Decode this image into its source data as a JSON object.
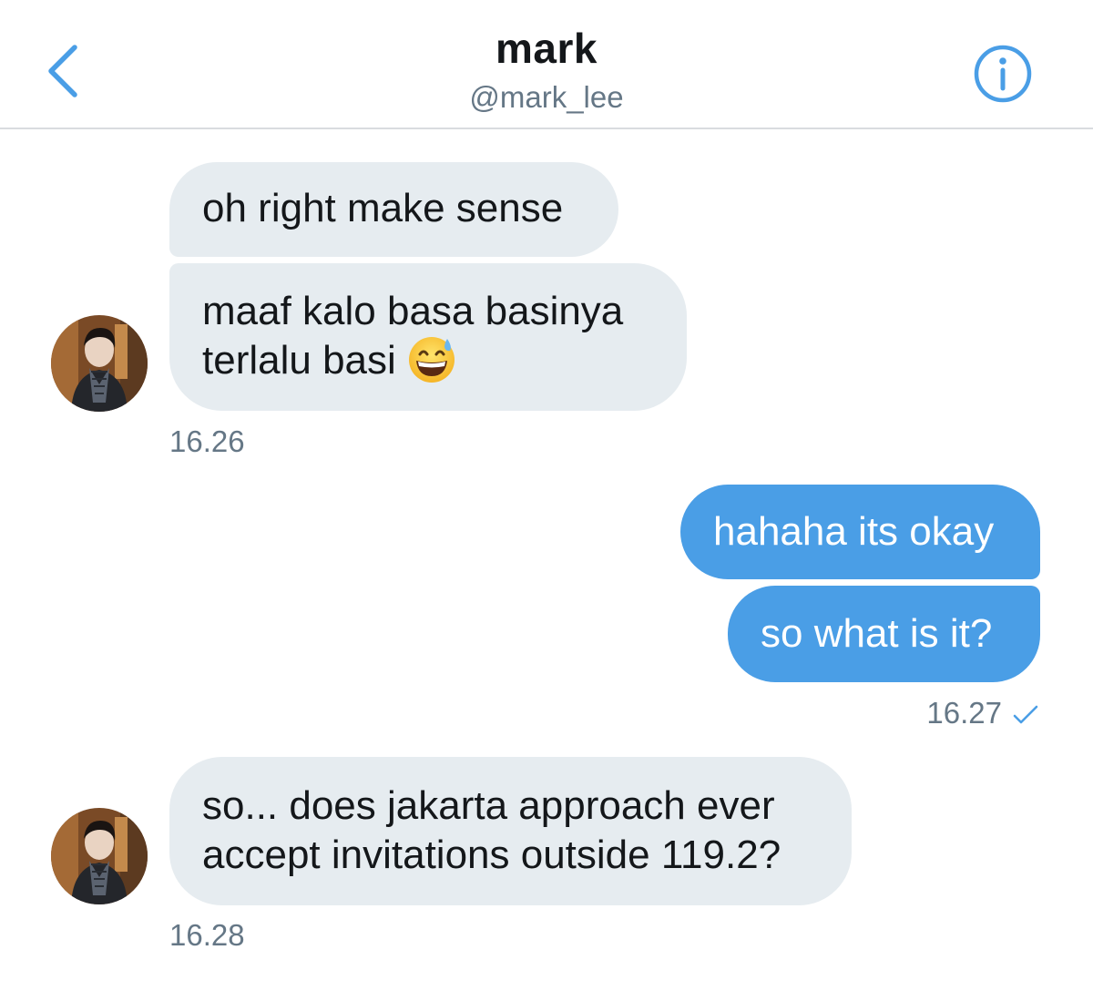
{
  "header": {
    "name": "mark",
    "handle": "@mark_lee"
  },
  "colors": {
    "accent": "#4a9ee6",
    "received_bubble": "#e6ecf0",
    "muted_text": "#657786"
  },
  "icons": {
    "back": "chevron-left-icon",
    "info": "info-circle-icon",
    "emoji": "grinning-sweat-emoji-icon",
    "read": "checkmark-icon"
  },
  "messages": [
    {
      "from": "them",
      "text": "oh right make sense"
    },
    {
      "from": "them",
      "lines": [
        "maaf kalo basa basinya",
        "terlalu basi"
      ]
    },
    {
      "from": "me",
      "text": "hahaha its okay"
    },
    {
      "from": "me",
      "text": "so what is it?"
    },
    {
      "from": "them",
      "lines": [
        "so... does jakarta approach ever",
        "accept invitations outside 119.2?"
      ]
    }
  ],
  "timestamps": {
    "group1": "16.26",
    "group2": "16.27",
    "group3": "16.28"
  }
}
